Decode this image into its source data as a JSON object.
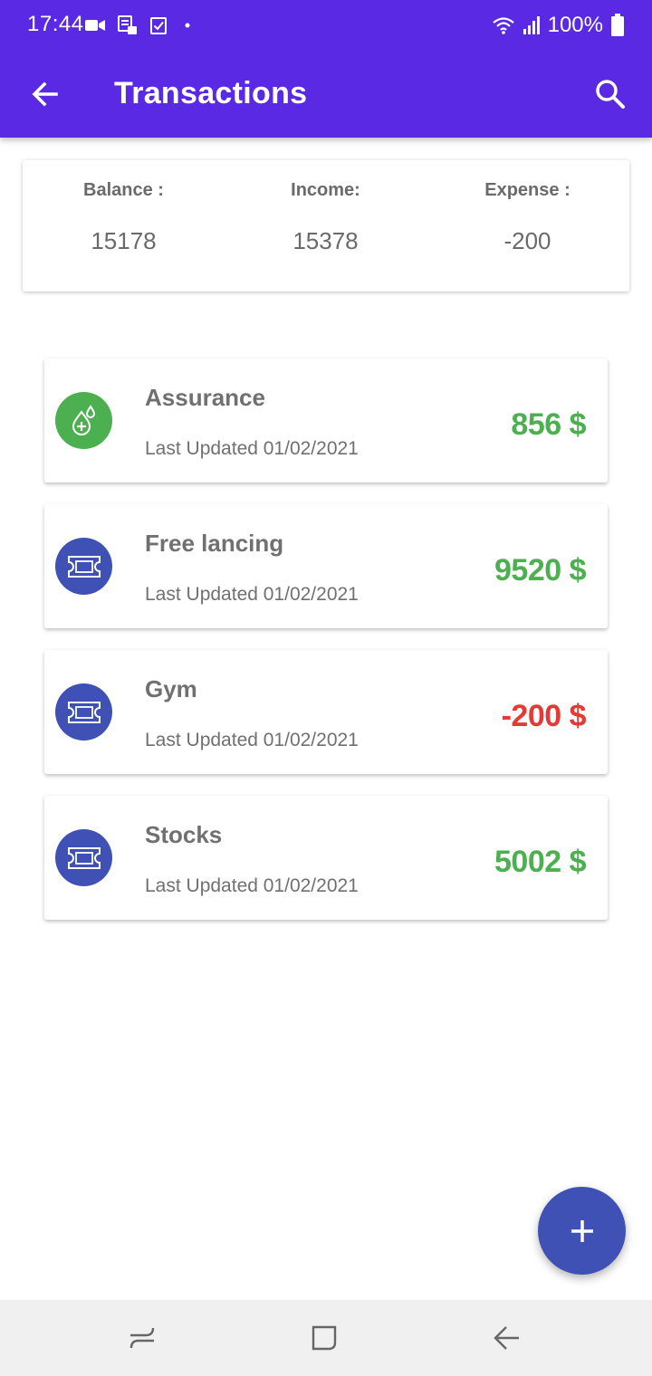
{
  "status_bar": {
    "time": "17:44",
    "battery_text": "100%",
    "icons_left": [
      "video-camera-icon",
      "sim-card-icon",
      "checkbox-icon",
      "dot-icon"
    ],
    "icons_right": [
      "wifi-icon",
      "signal-icon",
      "battery-icon"
    ]
  },
  "app_bar": {
    "title": "Transactions",
    "color": "#5a29e4",
    "back_icon": "arrow-left-icon",
    "search_icon": "search-icon"
  },
  "summary": {
    "balance_label": "Balance :",
    "balance_value": "15178",
    "income_label": "Income:",
    "income_value": "15378",
    "expense_label": "Expense :",
    "expense_value": "-200"
  },
  "transactions": [
    {
      "name": "Assurance",
      "updated": "Last Updated 01/02/2021",
      "amount": "856 $",
      "amount_color": "#4caf50",
      "icon": "medical-drop-icon",
      "icon_bg": "#4caf50"
    },
    {
      "name": "Free lancing",
      "updated": "Last Updated 01/02/2021",
      "amount": "9520 $",
      "amount_color": "#4caf50",
      "icon": "ticket-icon",
      "icon_bg": "#3f51b5"
    },
    {
      "name": "Gym",
      "updated": "Last Updated 01/02/2021",
      "amount": "-200 $",
      "amount_color": "#e53935",
      "icon": "ticket-icon",
      "icon_bg": "#3f51b5"
    },
    {
      "name": "Stocks",
      "updated": "Last Updated 01/02/2021",
      "amount": "5002 $",
      "amount_color": "#4caf50",
      "icon": "ticket-icon",
      "icon_bg": "#3f51b5"
    }
  ],
  "fab": {
    "icon": "plus-icon",
    "color": "#3f51b5"
  },
  "nav_bar": {
    "icons": [
      "recent-apps-icon",
      "home-icon",
      "back-icon"
    ]
  }
}
